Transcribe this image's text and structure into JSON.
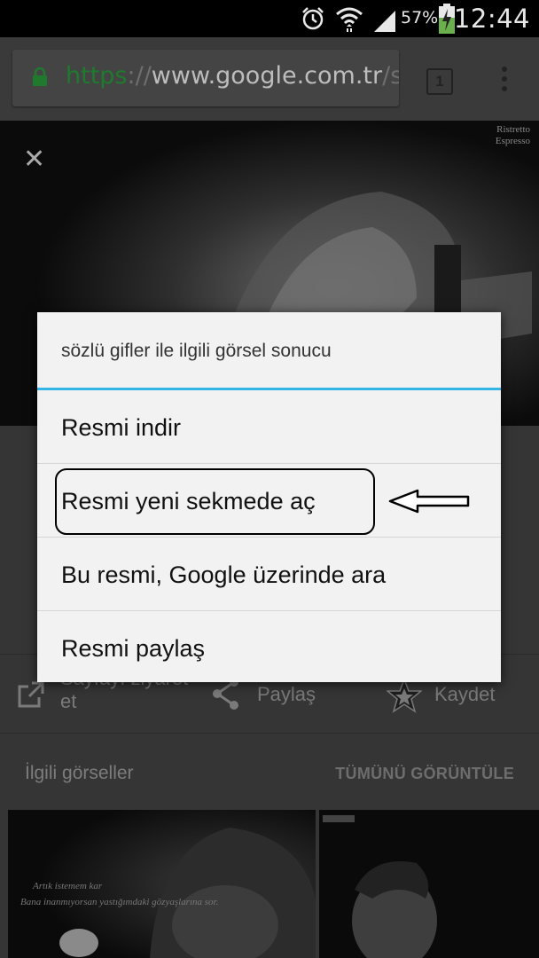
{
  "status_bar": {
    "time": "12:44",
    "battery_percent": "57%",
    "icons": [
      "alarm-icon",
      "wifi-icon",
      "signal-icon",
      "battery-charging-icon"
    ]
  },
  "browser": {
    "url_scheme": "https",
    "url_separator": "://",
    "url_host": "www.google.com.tr",
    "url_path": "/se",
    "tab_count": "1"
  },
  "viewer": {
    "close_glyph": "✕",
    "watermark_line1": "Ristretto",
    "watermark_line2": "Espresso"
  },
  "actions": {
    "visit_page_line1": "Sayfayı ziyaret",
    "visit_page_line2": "et",
    "share": "Paylaş",
    "save": "Kaydet"
  },
  "related": {
    "title": "İlgili görseller",
    "view_all": "TÜMÜNÜ GÖRÜNTÜLE",
    "thumb1_caption_line1": "Artık istemem kar",
    "thumb1_caption_line2": "Bana inanmıyorsan yastığımdaki gözyaşlarına sor."
  },
  "context_menu": {
    "title": "sözlü gifler ile ilgili görsel sonucu",
    "items": [
      "Resmi indir",
      "Resmi yeni sekmede aç",
      "Bu resmi, Google üzerinde ara",
      "Resmi paylaş"
    ]
  },
  "colors": {
    "accent_blue": "#33b5e5",
    "lock_green": "#1f7a2e",
    "dialog_bg": "#f2f2f2"
  }
}
